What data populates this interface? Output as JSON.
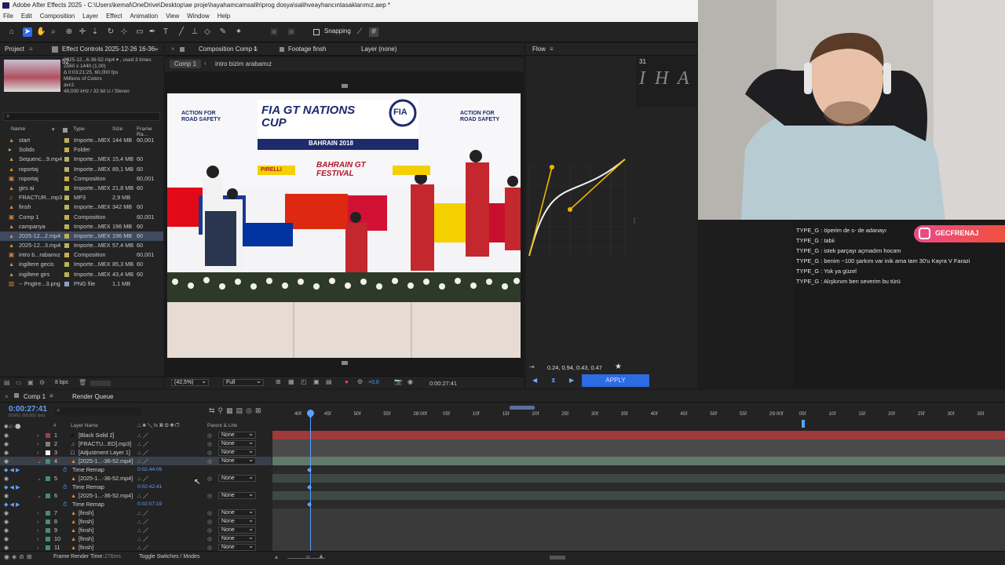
{
  "window": {
    "title": "Adobe After Effects 2025 - C:\\Users\\kemal\\OneDrive\\Desktop\\ae proje\\hayahamcamsalih\\prog dosya\\salihveayhancıntasaklarımız.aep *"
  },
  "menu": [
    "File",
    "Edit",
    "Composition",
    "Layer",
    "Effect",
    "Animation",
    "View",
    "Window",
    "Help"
  ],
  "toolbar": {
    "snapping_label": "Snapping"
  },
  "project_panel": {
    "tab_project": "Project",
    "tab_effect_controls": "Effect Controls 2025-12-26 16-36-52",
    "preview_info": [
      "2025-12...6-36-52.mp4 ▾ , used 3 times",
      "2560 x 1440 (1,00)",
      "Δ 0:03:21:25, 60,000 fps",
      "Millions of Colors",
      "avc1",
      "48,000 kHz / 32 bit U / Stereo"
    ],
    "search_placeholder": "",
    "columns": [
      "Name",
      "Type",
      "Size",
      "Frame Ra..."
    ],
    "items": [
      {
        "name": "start",
        "type": "Importe...MEX",
        "size": "144 MB",
        "fps": "60,001",
        "icon": "footage-icon",
        "color": "#b7b35a"
      },
      {
        "name": "Solids",
        "type": "Folder",
        "size": "",
        "fps": "",
        "icon": "folder-icon",
        "color": "#c8b046"
      },
      {
        "name": "Sequenc...9.mp4",
        "type": "Importe...MEX",
        "size": "15,4 MB",
        "fps": "60",
        "icon": "footage-icon",
        "color": "#b7b35a"
      },
      {
        "name": "roportaj",
        "type": "Importe...MEX",
        "size": "89,1 MB",
        "fps": "60",
        "icon": "footage-icon",
        "color": "#b7b35a"
      },
      {
        "name": "roportaj",
        "type": "Composition",
        "size": "",
        "fps": "60,001",
        "icon": "composition-icon",
        "color": "#c8b046"
      },
      {
        "name": "girs ai",
        "type": "Importe...MEX",
        "size": "21,8 MB",
        "fps": "60",
        "icon": "footage-icon",
        "color": "#b7b35a"
      },
      {
        "name": "FRACTUR...mp3",
        "type": "MP3",
        "size": "2,9 MB",
        "fps": "",
        "icon": "audio-icon",
        "color": "#b7b35a"
      },
      {
        "name": "finsh",
        "type": "Importe...MEX",
        "size": "342 MB",
        "fps": "60",
        "icon": "footage-icon",
        "color": "#b7b35a"
      },
      {
        "name": "Comp 1",
        "type": "Composition",
        "size": "",
        "fps": "60,001",
        "icon": "composition-icon",
        "color": "#c8b046"
      },
      {
        "name": "campanya",
        "type": "Importe...MEX",
        "size": "196 MB",
        "fps": "60",
        "icon": "footage-icon",
        "color": "#b7b35a"
      },
      {
        "name": "2025-12...2.mp4",
        "type": "Importe...MEX",
        "size": "196 MB",
        "fps": "60",
        "icon": "footage-icon",
        "color": "#b7b35a",
        "selected": true
      },
      {
        "name": "2025-12...3.mp4",
        "type": "Importe...MEX",
        "size": "57,4 MB",
        "fps": "60",
        "icon": "footage-icon",
        "color": "#b7b35a"
      },
      {
        "name": "intro b...rabamız",
        "type": "Composition",
        "size": "",
        "fps": "60,001",
        "icon": "composition-icon",
        "color": "#c8b046"
      },
      {
        "name": "ingiltere gecis",
        "type": "Importe...MEX",
        "size": "85,3 MB",
        "fps": "60",
        "icon": "footage-icon",
        "color": "#b7b35a"
      },
      {
        "name": "ingiltere girs",
        "type": "Importe...MEX",
        "size": "43,4 MB",
        "fps": "60",
        "icon": "footage-icon",
        "color": "#b7b35a"
      },
      {
        "name": "-- Pngtre...3.png",
        "type": "PNG file",
        "size": "1,1 MB",
        "fps": "",
        "icon": "image-icon",
        "color": "#8aa0c8"
      }
    ],
    "bpc": "8 bpc"
  },
  "comp_panel": {
    "tab_comp": "Composition Comp 1",
    "tab_footage": "Footage finsh",
    "tab_layer": "Layer (none)",
    "crumb_active": "Comp 1",
    "crumb_next": "intro bizim arabamız",
    "zoom": "(42,5%)",
    "resolution": "Full",
    "exposure": "+0,0",
    "timecode": "0:00:27:41",
    "viewer_text": {
      "logo_left": "ACTION FOR ROAD SAFETY",
      "logo_main": "FIA GT NATIONS CUP",
      "logo_fia": "FIA",
      "logo_right": "ACTION FOR ROAD SAFETY",
      "location": "BAHRAIN 2018",
      "festival": "BAHRAIN GT FESTIVAL",
      "sponsor": "PIRELLI"
    }
  },
  "flow_panel": {
    "title": "Flow",
    "bezier_values": "0.24, 0.94, 0.43, 0.47",
    "apply_label": "APPLY",
    "sketch_number": "31",
    "sketch_letters": "I H A"
  },
  "overlay": {
    "instagram_handle": "GECFRENAJ",
    "chat": [
      {
        "user": "TYPE_G",
        "text": "öperim de s- de adanayı"
      },
      {
        "user": "TYPE_G",
        "text": "tabii"
      },
      {
        "user": "TYPE_G",
        "text": "istek parçayı açmadım hocam"
      },
      {
        "user": "TYPE_G",
        "text": "benim ~100 şarkım var inik ama tam 30'u Kayra V Farazi"
      },
      {
        "user": "TYPE_G",
        "text": "Yok ya güzel"
      },
      {
        "user": "TYPE_G",
        "text": "Alışkınım ben severim bu türü"
      }
    ]
  },
  "timeline": {
    "tab_comp": "Comp 1",
    "tab_render": "Render Queue",
    "current_time": "0:00:27:41",
    "current_frames": "01661 (60,001 fps)",
    "col_layer_name": "Layer Name",
    "col_parent": "Parent & Link",
    "ruler": [
      "40f",
      "45f",
      "50f",
      "55f",
      "28:00f",
      "05f",
      "10f",
      "15f",
      "20f",
      "25f",
      "30f",
      "35f",
      "40f",
      "45f",
      "50f",
      "55f",
      "29:00f",
      "05f",
      "10f",
      "15f",
      "20f",
      "25f",
      "30f",
      "35f"
    ],
    "layers": [
      {
        "num": "1",
        "name": "[Black Solid 2]",
        "parent": "None",
        "icon": "solid-icon",
        "label": "#b03a3a",
        "track": "#9e3a3c"
      },
      {
        "num": "2",
        "name": "[FRACTU...ED].mp3]",
        "parent": "None",
        "icon": "audio-icon",
        "label": "#7f7f7f",
        "track": "#4a4a4a"
      },
      {
        "num": "3",
        "name": "[Adjustment Layer 1]",
        "parent": "None",
        "icon": "adjustment-icon",
        "label": "#ffffff",
        "track": "#4a4a4a"
      },
      {
        "num": "4",
        "name": "[2025-1...-36-52.mp4]",
        "parent": "None",
        "icon": "footage-icon",
        "label": "#4a8a7a",
        "track": "#627a6c",
        "selected": true
      },
      {
        "prop": "Time Remap",
        "value": "0:02:44:09"
      },
      {
        "num": "5",
        "name": "[2025-1...-36-52.mp4]",
        "parent": "None",
        "icon": "footage-icon",
        "label": "#4a8a7a",
        "track": "#3d4a44"
      },
      {
        "prop": "Time Remap",
        "value": "0:02:42:41"
      },
      {
        "num": "6",
        "name": "[2025-1...-36-52.mp4]",
        "parent": "None",
        "icon": "footage-icon",
        "label": "#4a8a7a",
        "track": "#3d4a44"
      },
      {
        "prop": "Time Remap",
        "value": "0:02:07:19"
      },
      {
        "num": "7",
        "name": "[finsh]",
        "parent": "None",
        "icon": "footage-icon",
        "label": "#4a8a7a",
        "track": "#3a3a3a"
      },
      {
        "num": "8",
        "name": "[finsh]",
        "parent": "None",
        "icon": "footage-icon",
        "label": "#4a8a7a",
        "track": "#3a3a3a"
      },
      {
        "num": "9",
        "name": "[finsh]",
        "parent": "None",
        "icon": "footage-icon",
        "label": "#4a8a7a",
        "track": "#3a3a3a"
      },
      {
        "num": "10",
        "name": "[finsh]",
        "parent": "None",
        "icon": "footage-icon",
        "label": "#4a8a7a",
        "track": "#3a3a3a"
      },
      {
        "num": "11",
        "name": "[finsh]",
        "parent": "None",
        "icon": "footage-icon",
        "label": "#4a8a7a",
        "track": "#3a3a3a"
      }
    ],
    "frame_render_label": "Frame Render Time:",
    "frame_render_value": "276ms",
    "toggle_label": "Toggle Switches / Modes"
  }
}
